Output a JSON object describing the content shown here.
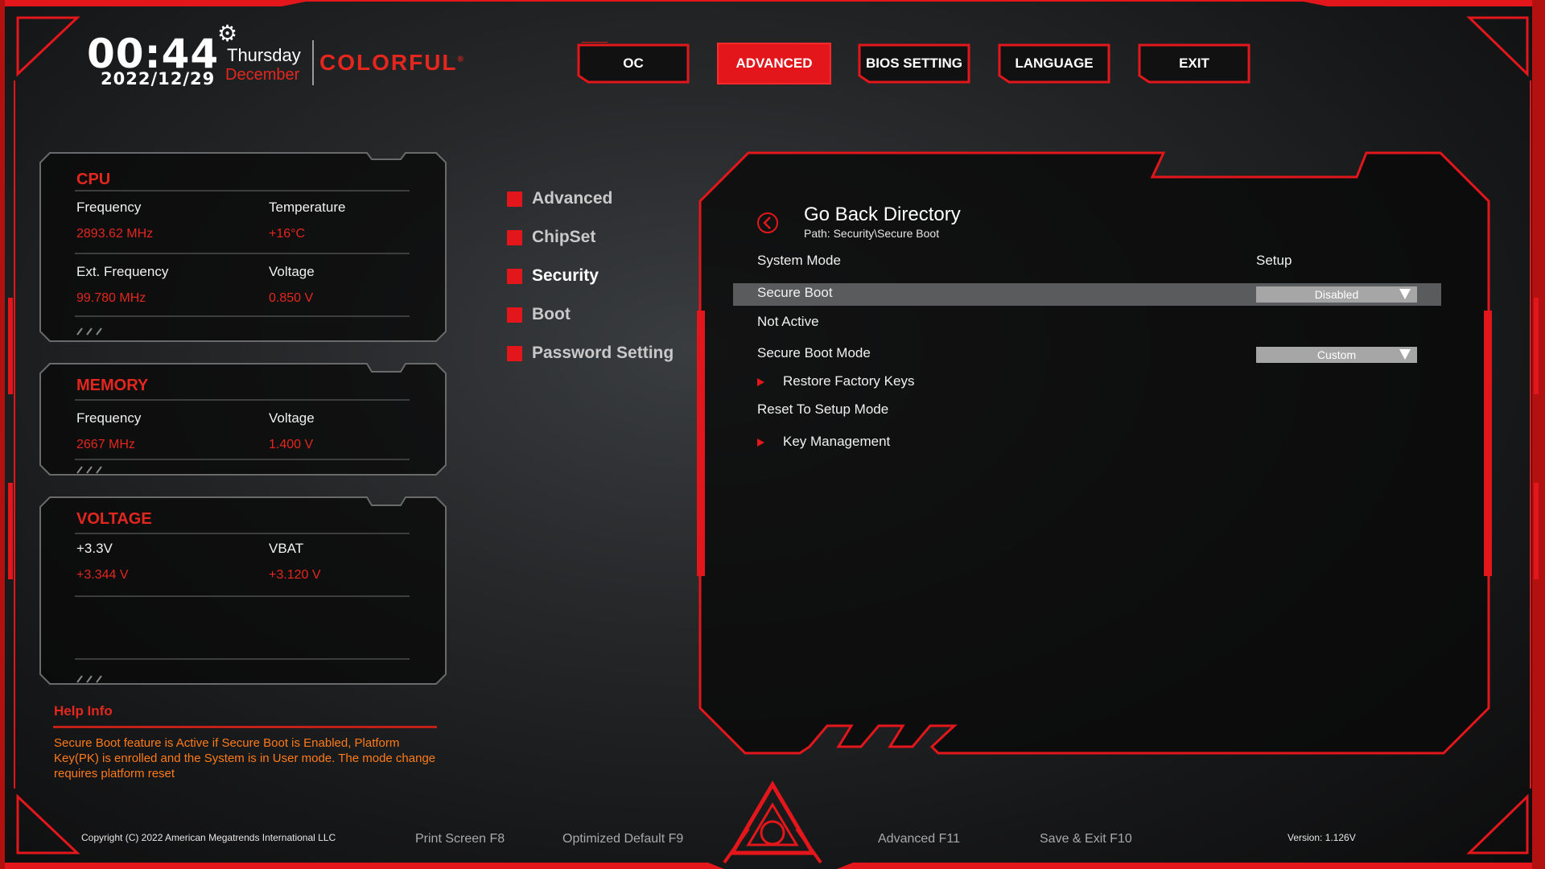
{
  "header": {
    "time": "00:44",
    "date": "2022/12/29",
    "day": "Thursday",
    "month": "December",
    "brand": "COLORFUL",
    "brand_mark": "®"
  },
  "nav": {
    "tabs": [
      {
        "label": "OC",
        "active": false
      },
      {
        "label": "ADVANCED",
        "active": true
      },
      {
        "label": "BIOS SETTING",
        "active": false
      },
      {
        "label": "LANGUAGE",
        "active": false
      },
      {
        "label": "EXIT",
        "active": false
      }
    ]
  },
  "cpu": {
    "title": "CPU",
    "frequency_label": "Frequency",
    "frequency_value": "2893.62 MHz",
    "temperature_label": "Temperature",
    "temperature_value": "+16°C",
    "ext_frequency_label": "Ext. Frequency",
    "ext_frequency_value": "99.780 MHz",
    "voltage_label": "Voltage",
    "voltage_value": "0.850 V"
  },
  "memory": {
    "title": "MEMORY",
    "frequency_label": "Frequency",
    "frequency_value": "2667 MHz",
    "voltage_label": "Voltage",
    "voltage_value": "1.400 V"
  },
  "voltage": {
    "title": "VOLTAGE",
    "v33_label": "+3.3V",
    "v33_value": "+3.344 V",
    "vbat_label": "VBAT",
    "vbat_value": "+3.120 V"
  },
  "help": {
    "title": "Help Info",
    "text": "Secure Boot feature is Active if Secure Boot is Enabled, Platform Key(PK) is enrolled and the System is in User mode. The mode change requires platform reset"
  },
  "menu": {
    "items": [
      {
        "label": "Advanced",
        "active": false
      },
      {
        "label": "ChipSet",
        "active": false
      },
      {
        "label": "Security",
        "active": true
      },
      {
        "label": "Boot",
        "active": false
      },
      {
        "label": "Password Setting",
        "active": false
      }
    ]
  },
  "main": {
    "go_back_title": "Go Back Directory",
    "path": "Path: Security\\Secure Boot",
    "system_mode_label": "System Mode",
    "system_mode_value": "Setup",
    "secure_boot_label": "Secure Boot",
    "secure_boot_value": "Disabled",
    "status_text": "Not Active",
    "secure_boot_mode_label": "Secure Boot Mode",
    "secure_boot_mode_value": "Custom",
    "restore_factory_keys": "Restore Factory Keys",
    "reset_to_setup_mode": "Reset To Setup Mode",
    "key_management": "Key Management"
  },
  "footer": {
    "copyright": "Copyright (C) 2022 American Megatrends International LLC",
    "print_screen": "Print Screen F8",
    "optimized_default": "Optimized Default F9",
    "advanced": "Advanced F11",
    "save_exit": "Save & Exit F10",
    "version": "Version: 1.126V"
  },
  "colors": {
    "accent_red": "#e3171b",
    "help_orange": "#ff7a1a",
    "background": "#1c1d1e"
  },
  "icons": {
    "gear": "gear-icon",
    "go_back": "back-arrow-icon",
    "logo": "colorful-emblem-icon"
  }
}
